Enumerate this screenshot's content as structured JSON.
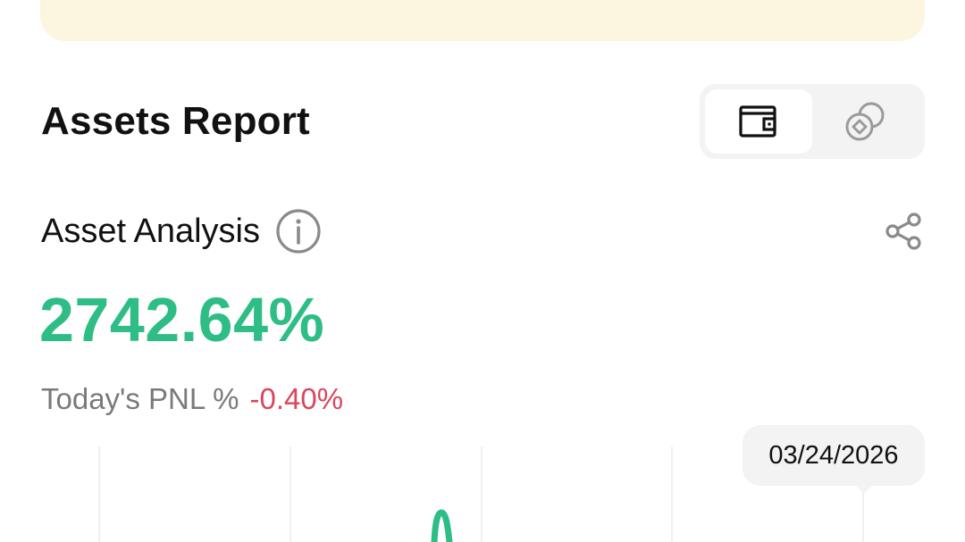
{
  "header": {
    "title": "Assets Report"
  },
  "view_toggle": {
    "options": [
      {
        "icon": "wallet-icon",
        "selected": true
      },
      {
        "icon": "coins-icon",
        "selected": false
      }
    ]
  },
  "analysis": {
    "label": "Asset Analysis",
    "info_icon": "info-icon",
    "share_icon": "share-icon",
    "total_pct": "2742.64%",
    "today_pnl_label": "Today's PNL %",
    "today_pnl_value": "-0.40%"
  },
  "chart": {
    "tooltip_date": "03/24/2026",
    "line_color": "#2DBD85"
  },
  "colors": {
    "positive": "#2DBD85",
    "negative": "#D9475C",
    "banner": "#FCF5E0",
    "toggle_bg": "#F3F3F3"
  }
}
